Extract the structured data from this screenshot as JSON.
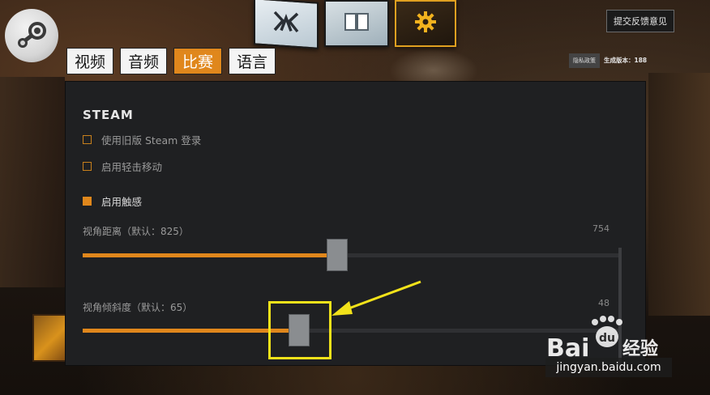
{
  "header": {
    "feedback_label": "提交反馈意见",
    "privacy_label": "隐私政策",
    "build_label": "生成版本：188"
  },
  "tabs": [
    {
      "label": "视频",
      "active": false
    },
    {
      "label": "音频",
      "active": false
    },
    {
      "label": "比赛",
      "active": true
    },
    {
      "label": "语言",
      "active": false
    }
  ],
  "panel": {
    "section_title": "STEAM",
    "options": [
      {
        "label": "使用旧版 Steam 登录",
        "checked": false
      },
      {
        "label": "启用轻击移动",
        "checked": false
      },
      {
        "label": "启用触感",
        "checked": true
      }
    ],
    "sliders": [
      {
        "label": "视角距离（默认：825）",
        "value": "754",
        "fill_fraction": 0.46
      },
      {
        "label": "视角倾斜度（默认：65）",
        "value": "48",
        "fill_fraction": 0.39
      }
    ]
  },
  "watermark": {
    "brand": "Baidu经验",
    "url": "jingyan.baidu.com"
  },
  "colors": {
    "accent": "#e0871c",
    "panel_bg": "#1f2022",
    "highlight": "#f2e21a"
  },
  "icons": {
    "logo": "steam-logo-icon",
    "card1": "dota-hero-icon",
    "card2": "book-icon",
    "card3": "gear-icon"
  }
}
